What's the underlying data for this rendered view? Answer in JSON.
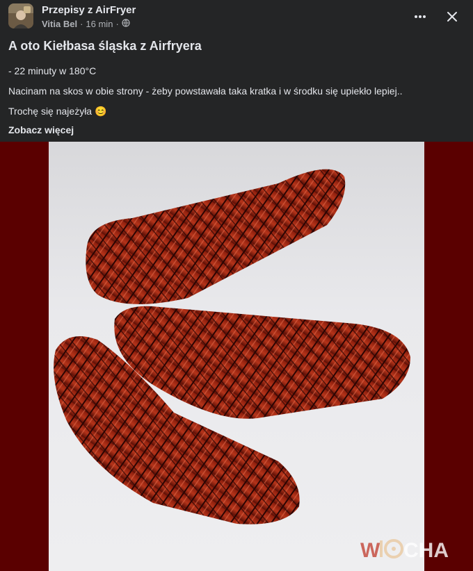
{
  "post": {
    "group_name": "Przepisy z AirFryer",
    "author": "Vitia Bel",
    "separator": "·",
    "time": "16 min",
    "privacy_icon": "globe-icon",
    "title": "A oto Kiełbasa śląska z Airfryera",
    "lines": [
      "- 22 minuty w 180°C",
      "Nacinam na skos w obie strony - żeby powstawała taka kratka i w środku się upiekło lepiej..",
      "Trochę się najeżyła"
    ],
    "emoji": "😊",
    "see_more": "Zobacz więcej"
  },
  "header_actions": {
    "more_icon": "more-icon",
    "close_icon": "close-icon"
  },
  "image": {
    "watermark": "WIOCHA",
    "background_color": "#5a0000"
  }
}
